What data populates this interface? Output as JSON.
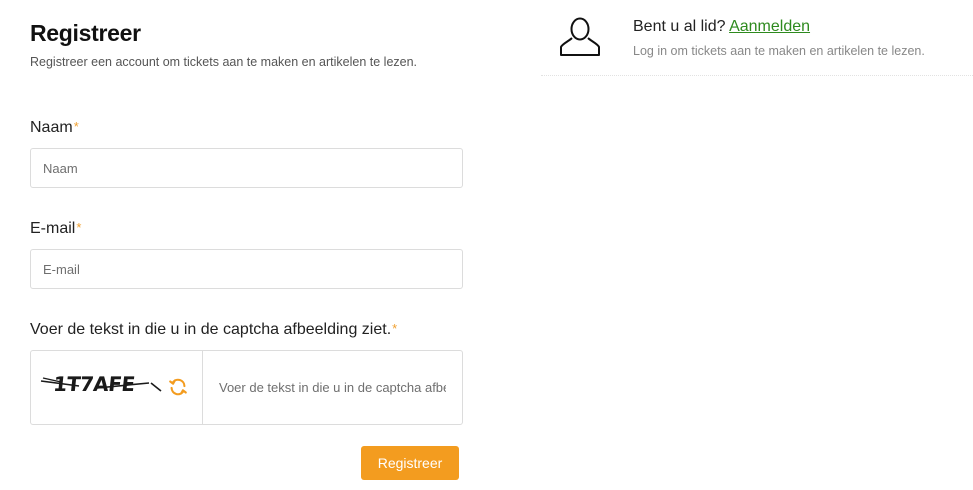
{
  "register": {
    "title": "Registreer",
    "subtitle": "Registreer een account om tickets aan te maken en artikelen te lezen.",
    "required_marker": "*",
    "fields": {
      "name": {
        "label": "Naam",
        "placeholder": "Naam"
      },
      "email": {
        "label": "E-mail",
        "placeholder": "E-mail"
      },
      "captcha": {
        "label": "Voer de tekst in die u in de captcha afbeelding ziet.",
        "placeholder": "Voer de tekst in die u in de captcha afbeelding ziet.",
        "image_text": "1T7AFE"
      }
    },
    "submit_label": "Registreer"
  },
  "login_prompt": {
    "question": "Bent u al lid?",
    "link_label": "Aanmelden",
    "subtitle": "Log in om tickets aan te maken en artikelen te lezen."
  },
  "icons": {
    "user": "user-outline-icon",
    "refresh": "refresh-icon"
  },
  "colors": {
    "accent": "#f39c1f",
    "link": "#2e8a1e",
    "required": "#f0a030",
    "border": "#dcdcdc"
  }
}
